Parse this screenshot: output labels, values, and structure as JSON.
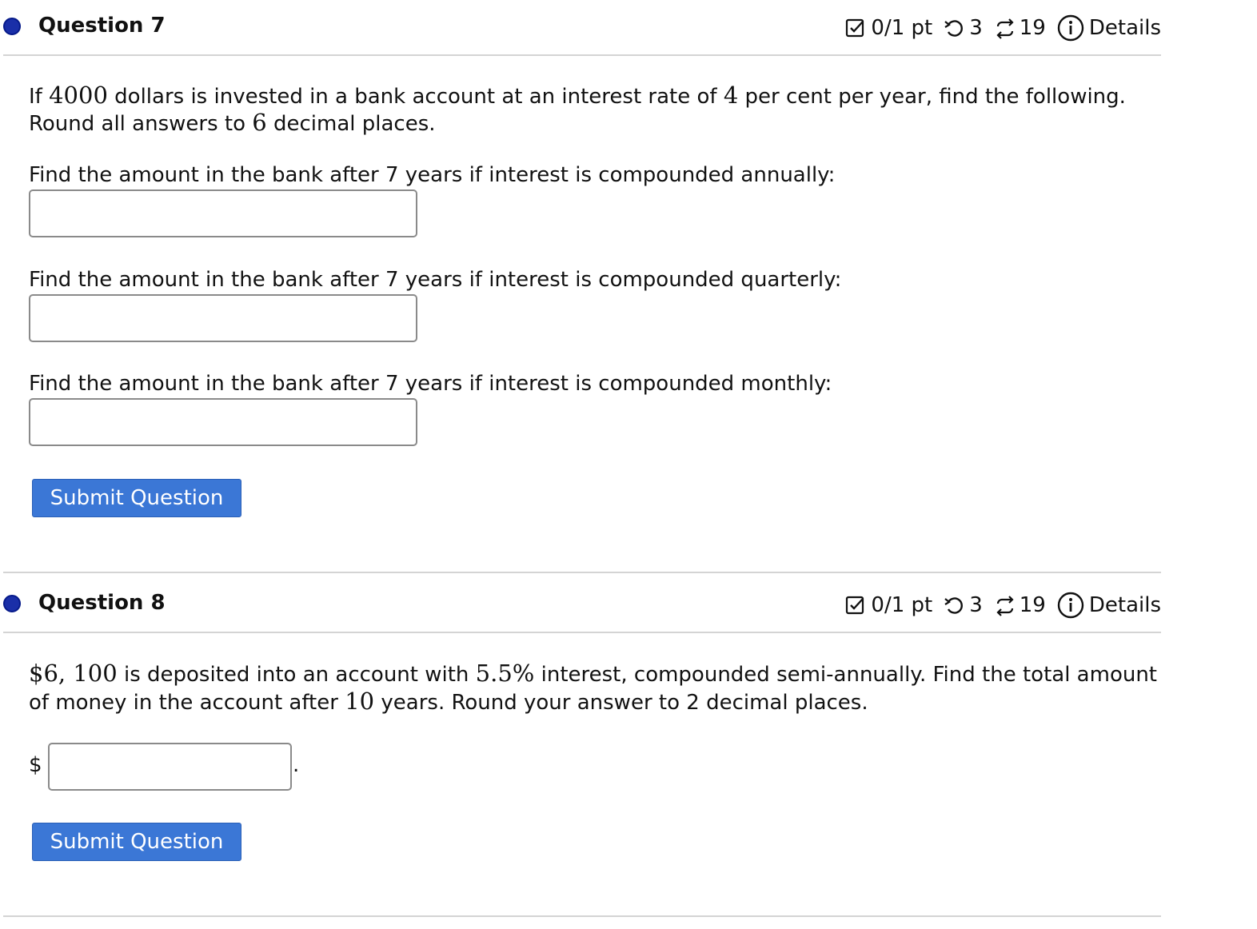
{
  "q7": {
    "title": "Question 7",
    "points": "0/1 pt",
    "retries": "3",
    "attempts": "19",
    "details_label": "Details",
    "intro_a": "If ",
    "principal": "4000",
    "intro_b": " dollars is invested in a bank account at an interest rate of ",
    "rate": "4",
    "intro_c": " per cent per year, find the following.",
    "round_a": "Round all answers to ",
    "decimals": "6",
    "round_b": " decimal places.",
    "part1": "Find the amount in the bank after 7 years if interest is compounded annually:",
    "part2": "Find the amount in the bank after 7 years if interest is compounded quarterly:",
    "part3": "Find the amount in the bank after 7 years if interest is compounded monthly:",
    "answer1": "",
    "answer2": "",
    "answer3": "",
    "submit_label": "Submit Question"
  },
  "q8": {
    "title": "Question 8",
    "points": "0/1 pt",
    "retries": "3",
    "attempts": "19",
    "details_label": "Details",
    "amount": "$6, 100",
    "text_a": " is deposited into an account with ",
    "rate": "5.5%",
    "text_b": " interest, compounded semi-annually. Find the total amount",
    "text_c": "of money in the account after ",
    "years": "10",
    "text_d": " years. Round your answer to 2 decimal places.",
    "currency": "$",
    "period": ".",
    "answer": "",
    "submit_label": "Submit Question"
  },
  "colors": {
    "bullet": "#1a2fa8",
    "button": "#3b77d6",
    "divider": "#d4d4d4"
  },
  "icons": [
    "checkbox-icon",
    "retry-icon",
    "attempts-icon",
    "info-icon"
  ]
}
